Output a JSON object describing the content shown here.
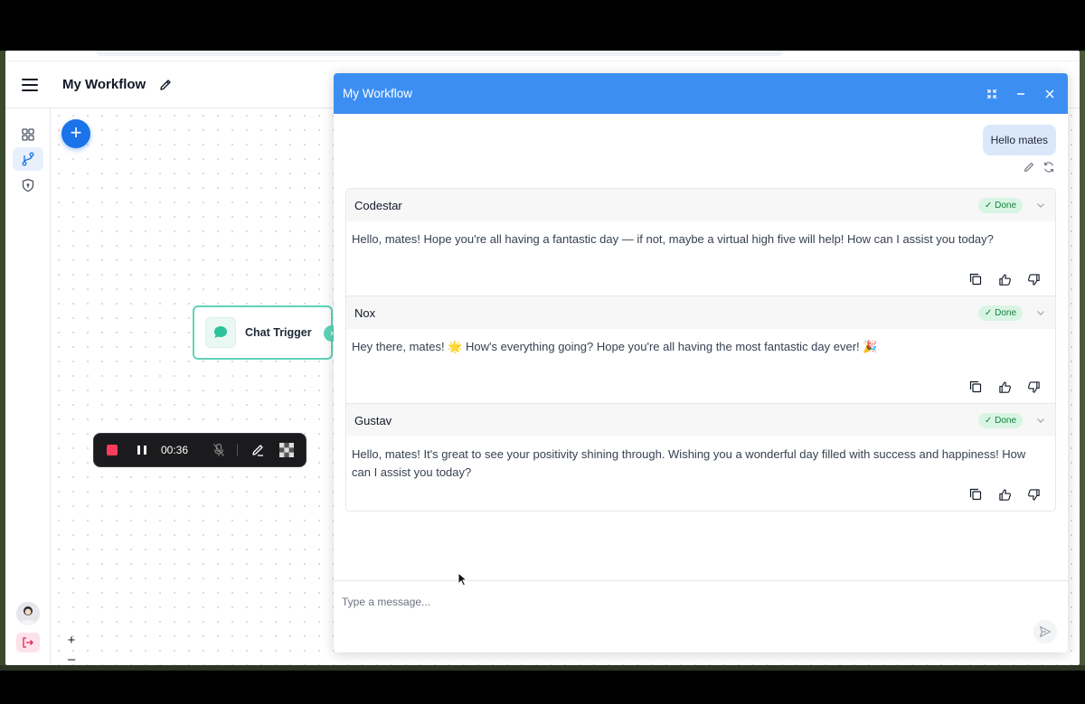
{
  "header": {
    "title": "My Workflow"
  },
  "sidebar": {
    "items": [
      {
        "icon": "grid-icon",
        "active": false
      },
      {
        "icon": "workflow-branch-icon",
        "active": true
      },
      {
        "icon": "shield-icon",
        "active": false
      }
    ]
  },
  "canvas": {
    "add_label": "+",
    "node": {
      "label": "Chat Trigger",
      "icon": "chat-bubble-icon"
    },
    "recorder": {
      "time": "00:36"
    },
    "zoom": [
      "+",
      "–",
      "⛶",
      "🔒"
    ]
  },
  "chat": {
    "title": "My Workflow",
    "user_message": "Hello mates",
    "responses": [
      {
        "name": "Codestar",
        "status": "Done",
        "text": "Hello, mates! Hope you're all having a fantastic day — if not, maybe a virtual high five will help! How can I assist you today?"
      },
      {
        "name": "Nox",
        "status": "Done",
        "text": "Hey there, mates! 🌟 How's everything going? Hope you're all having the most fantastic day ever! 🎉"
      },
      {
        "name": "Gustav",
        "status": "Done",
        "text": "Hello, mates! It's great to see your positivity shining through. Wishing you a wonderful day filled with success and happiness! How can I assist you today?"
      }
    ],
    "input_placeholder": "Type a message..."
  },
  "colors": {
    "accent": "#3d8ef2",
    "add_button": "#1a73e8",
    "node_border": "#5fd4b8",
    "badge_bg": "#d8f5e4",
    "badge_text": "#16803c",
    "record": "#ff3b5c"
  }
}
